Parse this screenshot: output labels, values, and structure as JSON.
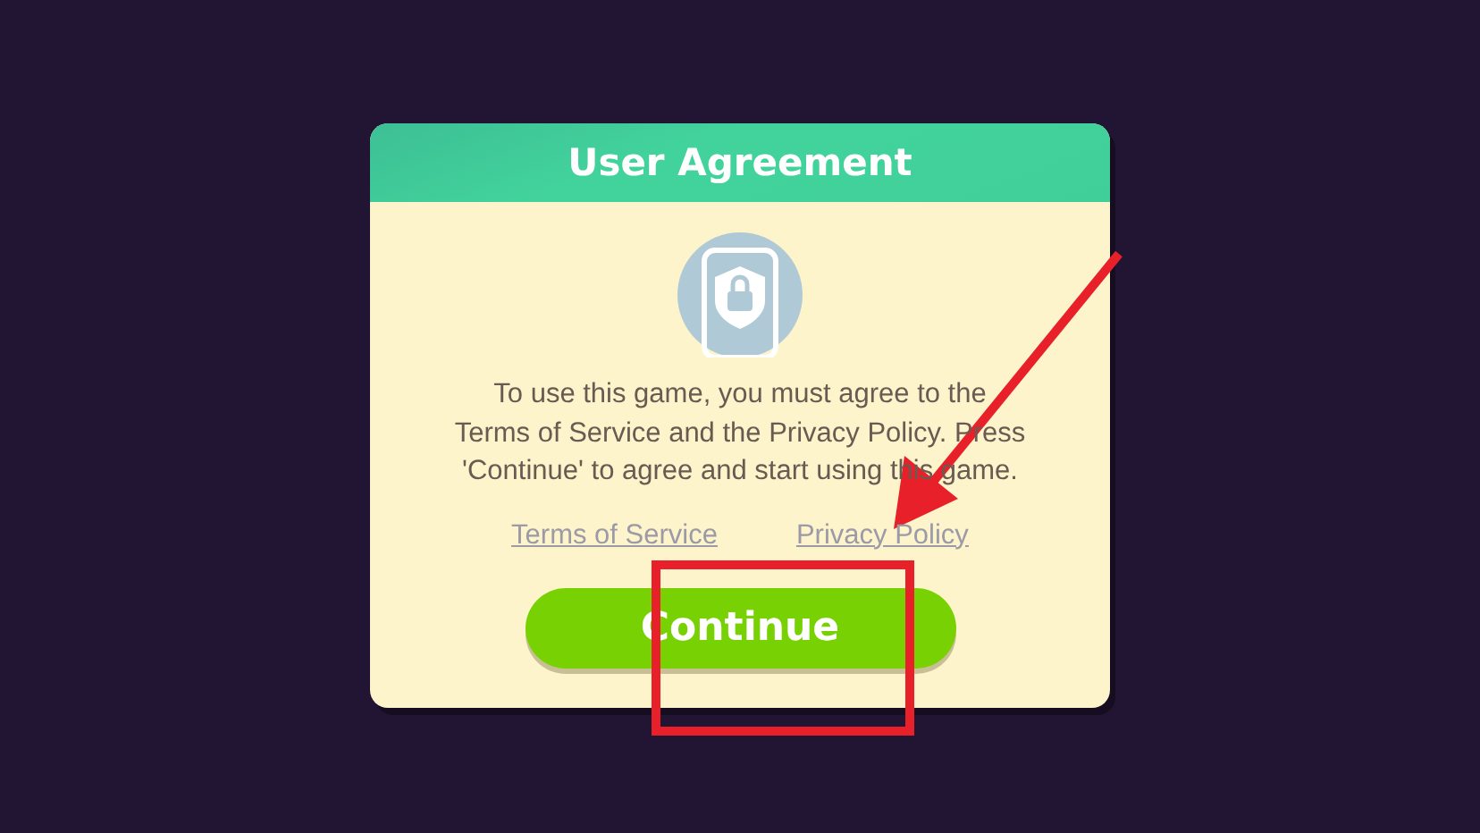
{
  "dialog": {
    "title": "User Agreement",
    "message_lines": [
      "To use this game, you must agree to the",
      "Terms of Service and the Privacy Policy. Press",
      "'Continue' to agree and start using this game."
    ],
    "links": [
      "Terms of Service",
      "Privacy Policy"
    ],
    "button": "Continue"
  },
  "annotations": {
    "arrow": true,
    "highlight_box": true
  }
}
